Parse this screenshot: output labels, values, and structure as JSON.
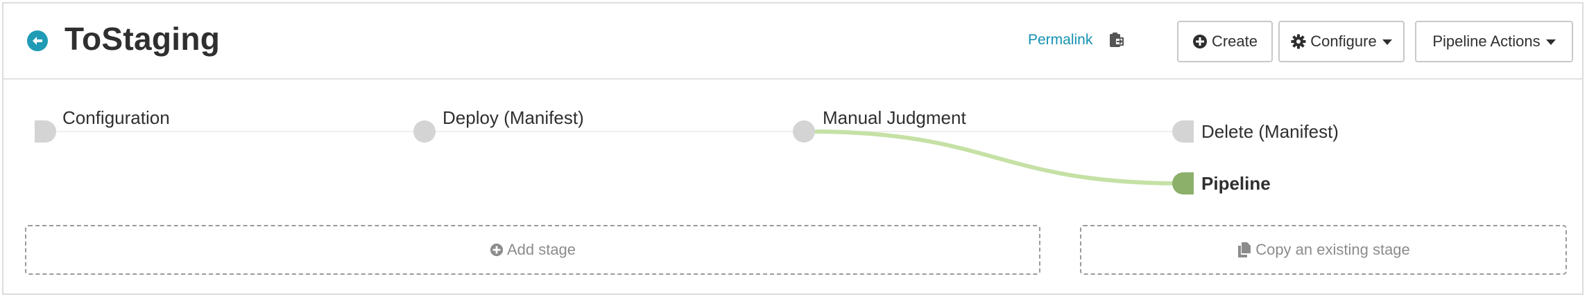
{
  "header": {
    "title": "ToStaging",
    "permalink": "Permalink",
    "buttons": {
      "create": "Create",
      "configure": "Configure",
      "pipeline_actions": "Pipeline Actions"
    }
  },
  "stages": {
    "configuration": "Configuration",
    "deploy": "Deploy (Manifest)",
    "manual_judgment": "Manual Judgment",
    "delete": "Delete (Manifest)",
    "pipeline": "Pipeline"
  },
  "actions": {
    "add_stage": "Add stage",
    "copy_stage": "Copy an existing stage"
  },
  "colors": {
    "accent": "#1f9bb5",
    "link": "#1491b3",
    "node_inactive": "#d4d4d4",
    "node_active": "#8cb06a",
    "active_path": "#c5e1a5"
  }
}
